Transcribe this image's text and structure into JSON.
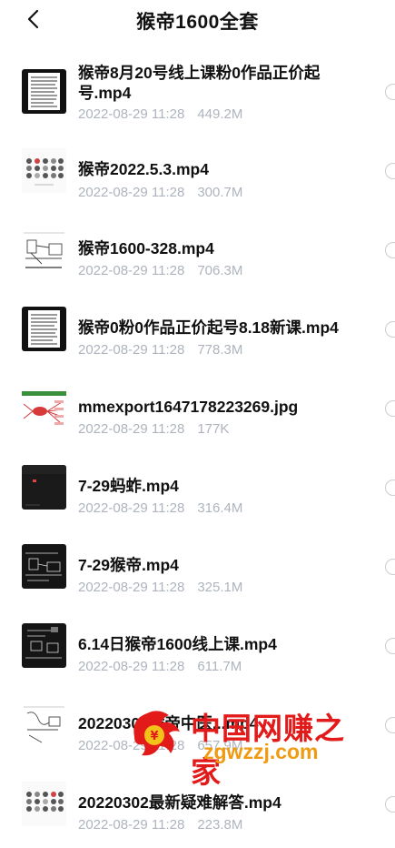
{
  "header": {
    "title": "猴帝1600全套",
    "back_icon": "chevron-left-icon"
  },
  "files": [
    {
      "name": "猴帝8月20号线上课粉0作品正价起号.mp4",
      "date": "2022-08-29 11:28",
      "size": "449.2M",
      "thumb": "document-thumbnail"
    },
    {
      "name": "猴帝2022.5.3.mp4",
      "date": "2022-08-29 11:28",
      "size": "300.7M",
      "thumb": "avatar-grid-thumbnail"
    },
    {
      "name": "猴帝1600-328.mp4",
      "date": "2022-08-29 11:28",
      "size": "706.3M",
      "thumb": "sketch-thumbnail"
    },
    {
      "name": "猴帝0粉0作品正价起号8.18新课.mp4",
      "date": "2022-08-29 11:28",
      "size": "778.3M",
      "thumb": "document-thumbnail"
    },
    {
      "name": "mmexport1647178223269.jpg",
      "date": "2022-08-29 11:28",
      "size": "177K",
      "thumb": "mindmap-thumbnail"
    },
    {
      "name": "7-29蚂蚱.mp4",
      "date": "2022-08-29 11:28",
      "size": "316.4M",
      "thumb": "dark-video-thumbnail"
    },
    {
      "name": "7-29猴帝.mp4",
      "date": "2022-08-29 11:28",
      "size": "325.1M",
      "thumb": "dark-diagram-thumbnail"
    },
    {
      "name": "6.14日猴帝1600线上课.mp4",
      "date": "2022-08-29 11:28",
      "size": "611.7M",
      "thumb": "dark-diagram-thumbnail"
    },
    {
      "name": "20220301猴帝中医...mp4",
      "date": "2022-08-29 11:28",
      "size": "657.9M",
      "thumb": "sketch-thumbnail"
    },
    {
      "name": "20220302最新疑难解答.mp4",
      "date": "2022-08-29 11:28",
      "size": "223.8M",
      "thumb": "avatar-grid-thumbnail"
    }
  ],
  "watermark": {
    "text_cn": "中国网赚之家",
    "text_url": "zgwzzj.com"
  },
  "colors": {
    "meta_text": "#aeb4bd",
    "radio_border": "#c9ccd1",
    "watermark_red": "#e21a1a",
    "watermark_orange": "#f09a12"
  }
}
